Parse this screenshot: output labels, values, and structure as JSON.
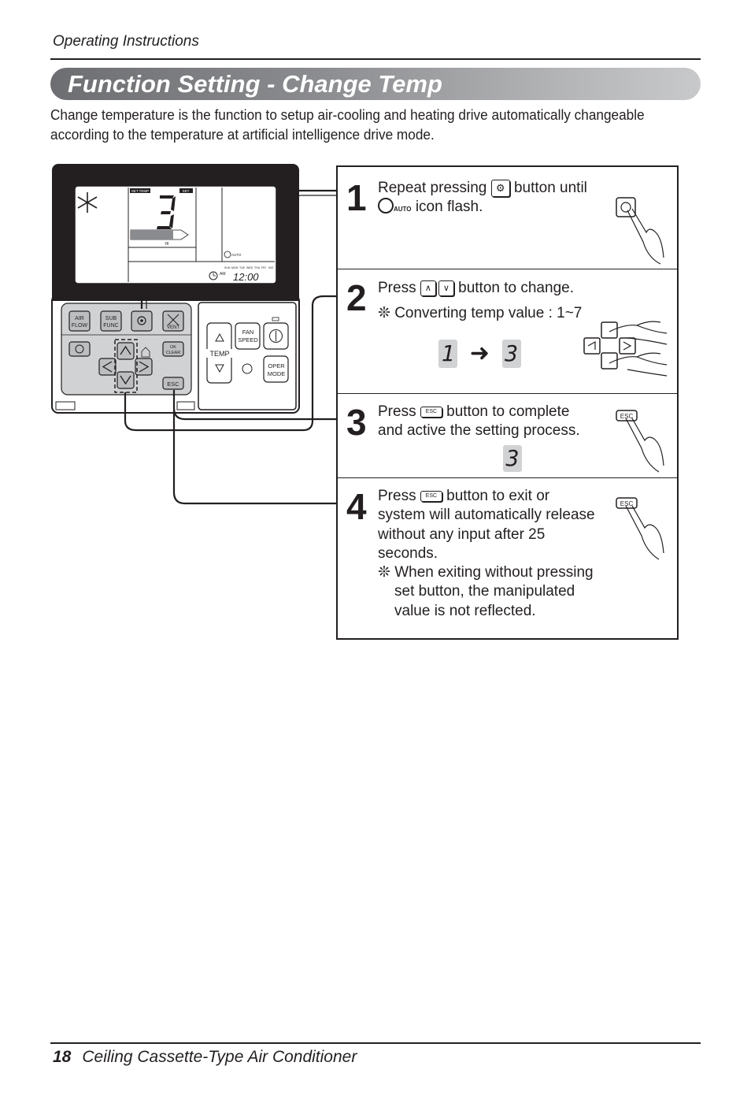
{
  "header": {
    "section": "Operating Instructions"
  },
  "title": "Function Setting - Change Temp",
  "intro": [
    "Change temperature is the function to setup air-cooling and heating drive automatically changeable",
    "according to the temperature at artificial intelligence drive mode."
  ],
  "remote": {
    "lcd": {
      "set_temp_label": "SET TEMP",
      "set_label": "SET",
      "temp_digit": "3",
      "fan_level": "HI",
      "auto_label": "AUTO",
      "days": [
        "SUN",
        "MON",
        "TUE",
        "WED",
        "THU",
        "FRI",
        "SAT"
      ],
      "am_label": "AM",
      "clock": "12:00"
    },
    "buttons": {
      "air_flow": [
        "AIR",
        "FLOW"
      ],
      "sub_func": [
        "SUB",
        "FUNC"
      ],
      "vent": "VENT",
      "ok": "OK",
      "clear": "CLEAR",
      "esc": "ESC",
      "fan_speed": [
        "FAN",
        "SPEED"
      ],
      "oper_mode": [
        "OPER",
        "MODE"
      ],
      "temp": "TEMP"
    }
  },
  "steps": [
    {
      "num": "1",
      "lines": [
        "Repeat pressing",
        "button until",
        "icon flash."
      ],
      "auto_label": "AUTO"
    },
    {
      "num": "2",
      "lines": [
        "Press",
        "button to change."
      ],
      "note": "❊ Converting temp value : 1~7",
      "from": "1",
      "to": "3"
    },
    {
      "num": "3",
      "lines": [
        "Press",
        "button to complete",
        "and active the setting process."
      ],
      "esc_label": "ESC",
      "value": "3"
    },
    {
      "num": "4",
      "lines": [
        "Press",
        "button to exit or",
        "system will automatically release",
        "without any input after 25",
        "seconds."
      ],
      "esc_label": "ESC",
      "note": [
        "❊ When exiting without pressing",
        "set button, the manipulated",
        "value is not reflected."
      ]
    }
  ],
  "footer": {
    "page": "18",
    "title": "Ceiling Cassette-Type Air Conditioner"
  }
}
